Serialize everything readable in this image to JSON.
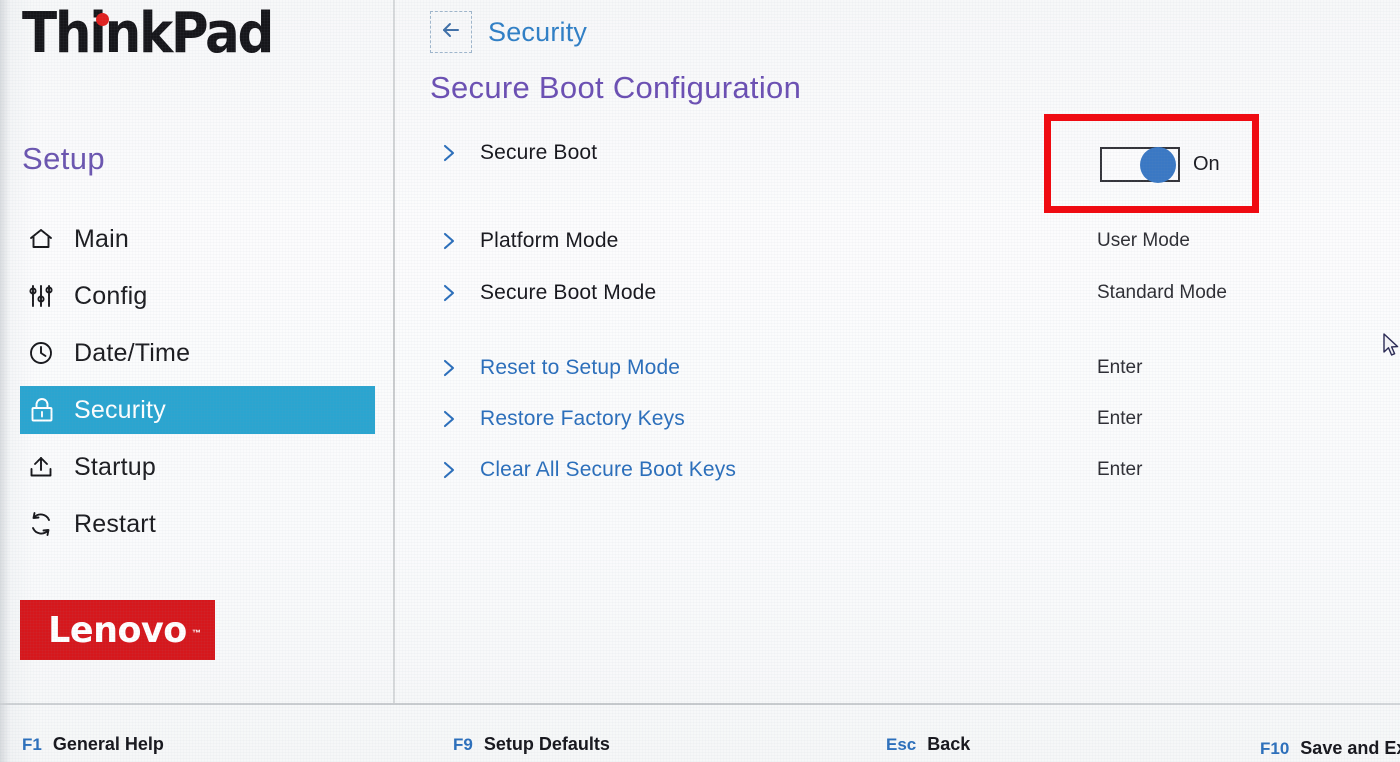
{
  "brand": {
    "logo_text": "ThinkPad",
    "setup_label": "Setup",
    "vendor_logo_text": "Lenovo",
    "vendor_tm": "™"
  },
  "colors": {
    "accent_blue": "#2a6ebb",
    "highlight_cyan": "#2aa5d0",
    "title_purple": "#6b4fb3",
    "annotation_red": "#ef0b12",
    "vendor_red": "#d6171c",
    "toggle_knob_blue": "#3a78c4"
  },
  "sidebar": {
    "items": [
      {
        "label": "Main",
        "icon": "home-icon",
        "active": false
      },
      {
        "label": "Config",
        "icon": "sliders-icon",
        "active": false
      },
      {
        "label": "Date/Time",
        "icon": "clock-icon",
        "active": false
      },
      {
        "label": "Security",
        "icon": "lock-icon",
        "active": true
      },
      {
        "label": "Startup",
        "icon": "upload-icon",
        "active": false
      },
      {
        "label": "Restart",
        "icon": "refresh-icon",
        "active": false
      }
    ]
  },
  "header": {
    "back_icon": "back-arrow-icon",
    "breadcrumb": "Security",
    "title": "Secure Boot Configuration"
  },
  "main": {
    "rows": [
      {
        "label": "Secure Boot",
        "style": "dark",
        "value": "",
        "control": "toggle"
      },
      {
        "label": "Platform Mode",
        "style": "dark",
        "value": "User Mode",
        "control": "text"
      },
      {
        "label": "Secure Boot Mode",
        "style": "dark",
        "value": "Standard Mode",
        "control": "text"
      },
      {
        "label": "Reset to Setup Mode",
        "style": "link",
        "value": "Enter",
        "control": "text"
      },
      {
        "label": "Restore Factory Keys",
        "style": "link",
        "value": "Enter",
        "control": "text"
      },
      {
        "label": "Clear All Secure Boot Keys",
        "style": "link",
        "value": "Enter",
        "control": "text"
      }
    ],
    "secure_boot_toggle": {
      "state": "On",
      "label": "On"
    }
  },
  "footer": {
    "keys": [
      {
        "key": "F1",
        "label": "General Help"
      },
      {
        "key": "F9",
        "label": "Setup Defaults"
      },
      {
        "key": "Esc",
        "label": "Back"
      },
      {
        "key": "F10",
        "label": "Save and Exit"
      }
    ]
  }
}
